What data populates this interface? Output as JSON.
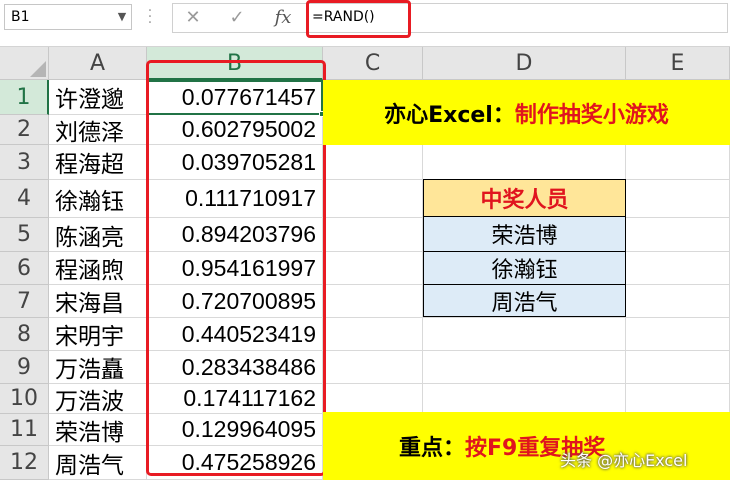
{
  "formula_bar": {
    "name_box": "B1",
    "formula": "=RAND()",
    "cancel_icon": "✕",
    "enter_icon": "✓",
    "fx_icon": "fx"
  },
  "columns": [
    "A",
    "B",
    "C",
    "D",
    "E"
  ],
  "rows": [
    "1",
    "2",
    "3",
    "4",
    "5",
    "6",
    "7",
    "8",
    "9",
    "10",
    "11",
    "12"
  ],
  "names": [
    "许澄邈",
    "刘德泽",
    "程海超",
    "徐瀚钰",
    "陈涵亮",
    "程涵煦",
    "宋海昌",
    "宋明宇",
    "万浩矗",
    "万浩波",
    "荣浩博",
    "周浩气"
  ],
  "values": [
    "0.077671457",
    "0.602795002",
    "0.039705281",
    "0.111710917",
    "0.894203796",
    "0.954161997",
    "0.720700895",
    "0.440523419",
    "0.283438486",
    "0.174117162",
    "0.129964095",
    "0.475258926"
  ],
  "banner_top": {
    "prefix": "亦心Excel：",
    "text": "制作抽奖小游戏"
  },
  "banner_bottom": {
    "prefix": "重点：",
    "text": "按F9重复抽奖"
  },
  "winners": {
    "header": "中奖人员",
    "items": [
      "荣浩博",
      "徐瀚钰",
      "周浩气"
    ]
  },
  "watermark": "头条 @亦心Excel",
  "colors": {
    "accent_green": "#217346",
    "highlight_red": "#e81b23",
    "banner_yellow": "#ffff00",
    "header_gold": "#ffe699",
    "cell_blue": "#ddebf7"
  }
}
